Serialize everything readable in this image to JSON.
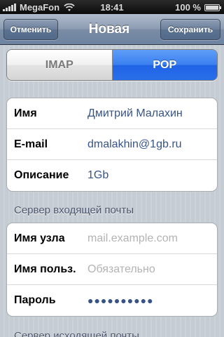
{
  "status_bar": {
    "carrier": "MegaFon",
    "time": "18:41",
    "battery": "100 %",
    "icons": [
      "signal-icon",
      "wifi-icon",
      "battery-icon"
    ]
  },
  "nav": {
    "cancel_label": "Отменить",
    "title": "Новая",
    "save_label": "Сохранить"
  },
  "segmented": {
    "options": [
      "IMAP",
      "POP"
    ],
    "selected": "POP"
  },
  "account_group": [
    {
      "label": "Имя",
      "value": "Дмитрий Малахин"
    },
    {
      "label": "E-mail",
      "value": "dmalakhin@1gb.ru"
    },
    {
      "label": "Описание",
      "value": "1Gb"
    }
  ],
  "incoming": {
    "header": "Сервер входящей почты",
    "rows": [
      {
        "label": "Имя узла",
        "placeholder": "mail.example.com"
      },
      {
        "label": "Имя польз.",
        "placeholder": "Обязательно"
      },
      {
        "label": "Пароль",
        "value": "●●●●●●●●●●"
      }
    ]
  },
  "outgoing": {
    "header": "Сервер исходящей почты"
  },
  "colors": {
    "value_text": "#385487",
    "placeholder_text": "#b3b3b3",
    "segment_active": "#2a6fe9"
  }
}
